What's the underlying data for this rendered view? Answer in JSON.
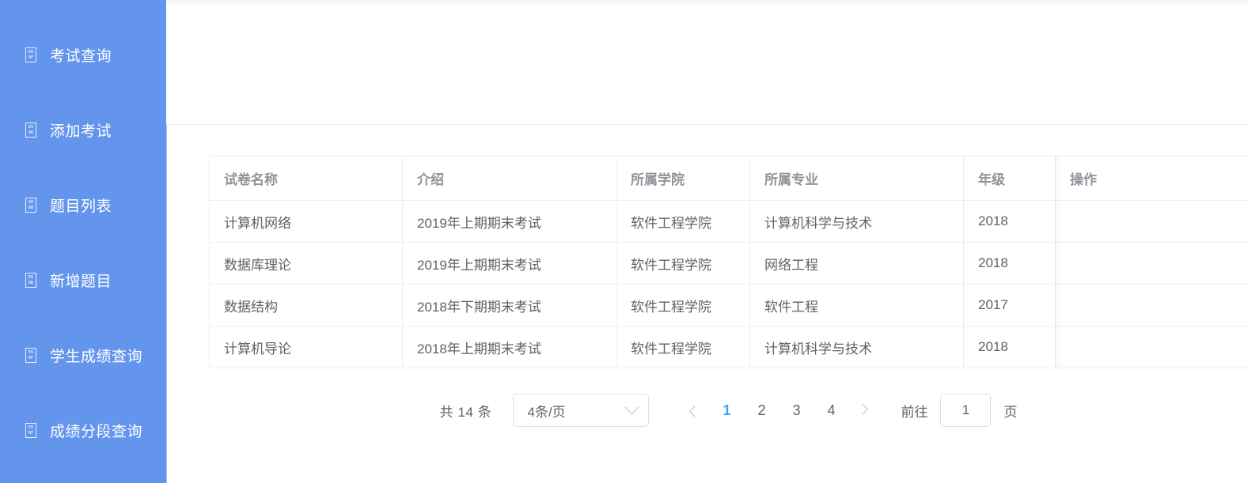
{
  "theme": {
    "sidebar_bg": "#6495ED",
    "accent": "#409eff",
    "header_text": "#909399",
    "body_text": "#606266",
    "border": "#ebeef5"
  },
  "sidebar": {
    "items": [
      {
        "icon": "missing-glyph-e60f-icon",
        "hex_top": "E6",
        "hex_bottom": "0F",
        "label": "考试查询"
      },
      {
        "icon": "missing-glyph-e60d-icon",
        "hex_top": "E6",
        "hex_bottom": "0D",
        "label": "添加考试"
      },
      {
        "icon": "missing-glyph-e608-icon",
        "hex_top": "E6",
        "hex_bottom": "08",
        "label": "题目列表"
      },
      {
        "icon": "missing-glyph-e60d-icon",
        "hex_top": "E6",
        "hex_bottom": "0D",
        "label": "新增题目"
      },
      {
        "icon": "missing-glyph-e60f-icon",
        "hex_top": "E6",
        "hex_bottom": "0F",
        "label": "学生成绩查询"
      },
      {
        "icon": "missing-glyph-e60f-icon",
        "hex_top": "E6",
        "hex_bottom": "0F",
        "label": "成绩分段查询"
      }
    ]
  },
  "table": {
    "columns": [
      {
        "key": "name",
        "label": "试卷名称"
      },
      {
        "key": "intro",
        "label": "介绍"
      },
      {
        "key": "college",
        "label": "所属学院"
      },
      {
        "key": "major",
        "label": "所属专业"
      },
      {
        "key": "grade",
        "label": "年级"
      },
      {
        "key": "action",
        "label": "操作"
      }
    ],
    "rows": [
      {
        "name": "计算机网络",
        "intro": "2019年上期期末考试",
        "college": "软件工程学院",
        "major": "计算机科学与技术",
        "grade": "2018",
        "action": ""
      },
      {
        "name": "数据库理论",
        "intro": "2019年上期期末考试",
        "college": "软件工程学院",
        "major": "网络工程",
        "grade": "2018",
        "action": ""
      },
      {
        "name": "数据结构",
        "intro": "2018年下期期末考试",
        "college": "软件工程学院",
        "major": "软件工程",
        "grade": "2017",
        "action": ""
      },
      {
        "name": "计算机导论",
        "intro": "2018年上期期末考试",
        "college": "软件工程学院",
        "major": "计算机科学与技术",
        "grade": "2018",
        "action": ""
      }
    ]
  },
  "pagination": {
    "total_text": "共 14 条",
    "page_size_value": "4条/页",
    "prev_label": "‹",
    "next_label": "›",
    "pages": [
      "1",
      "2",
      "3",
      "4"
    ],
    "current_page": "1",
    "jump_label": "前往",
    "jump_value": "1",
    "jump_unit": "页"
  }
}
